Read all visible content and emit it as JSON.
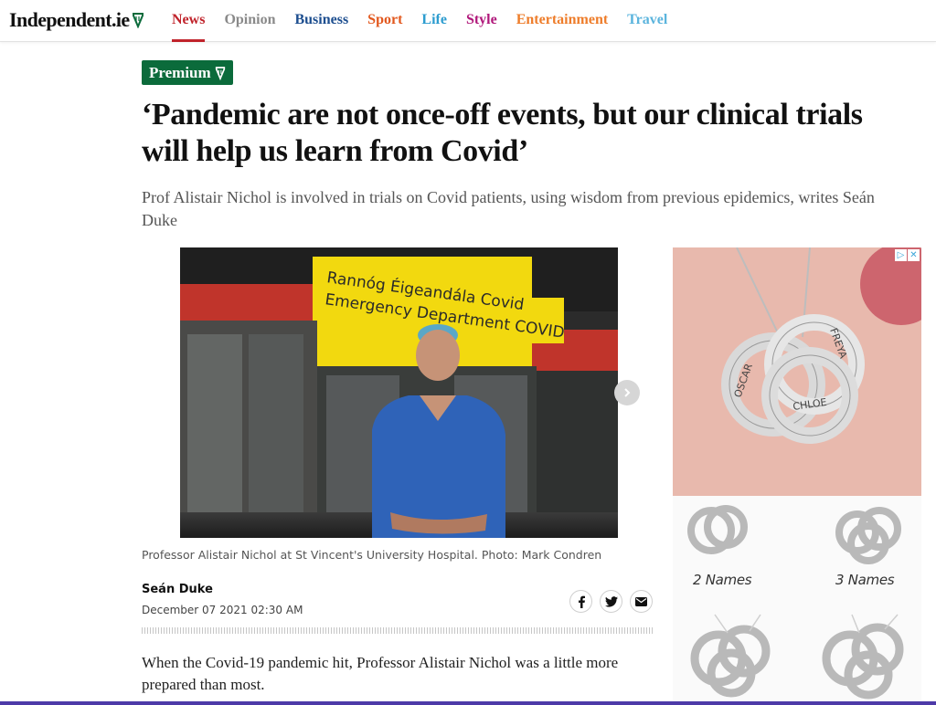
{
  "nav": {
    "logo": "Independent.ie",
    "links": [
      {
        "label": "News",
        "color": "#c0232b",
        "active": true
      },
      {
        "label": "Opinion",
        "color": "#8a8a8a",
        "active": false
      },
      {
        "label": "Business",
        "color": "#1d4e8f",
        "active": false
      },
      {
        "label": "Sport",
        "color": "#e2581e",
        "active": false
      },
      {
        "label": "Life",
        "color": "#2c9ccf",
        "active": false
      },
      {
        "label": "Style",
        "color": "#b0177a",
        "active": false
      },
      {
        "label": "Entertainment",
        "color": "#ee7d2b",
        "active": false
      },
      {
        "label": "Travel",
        "color": "#5bb4dd",
        "active": false
      }
    ]
  },
  "article": {
    "badge": "Premium",
    "headline": "‘Pandemic are not once-off events, but our clinical trials will help us learn from Covid’",
    "standfirst": "Prof Alistair Nichol is involved in trials on Covid patients, using wisdom from previous epidemics, writes Seán Duke",
    "photo_caption": "Professor Alistair Nichol at St Vincent's University Hospital. Photo: Mark Condren",
    "photo_sign_line1": "Rannóg Éigeandála Covid",
    "photo_sign_line2": "Emergency Department COVID",
    "author": "Seán Duke",
    "date": "December 07 2021 02:30 AM",
    "body_first_paragraph": "When the Covid-19 pandemic hit, Professor Alistair Nichol was a little more prepared than most."
  },
  "share_icons": [
    "facebook-icon",
    "twitter-icon",
    "email-icon"
  ],
  "ad": {
    "top_names": [
      "OSCAR",
      "FREYA",
      "CHLOE"
    ],
    "tiles": [
      {
        "label": "2 Names"
      },
      {
        "label": "3 Names"
      }
    ],
    "colors": {
      "ad_bg": "#e8b9ad",
      "silver": "#d9d9d9"
    }
  },
  "colors": {
    "premium_green": "#0b6b3b",
    "bottom_bar": "#4d3aa8"
  }
}
